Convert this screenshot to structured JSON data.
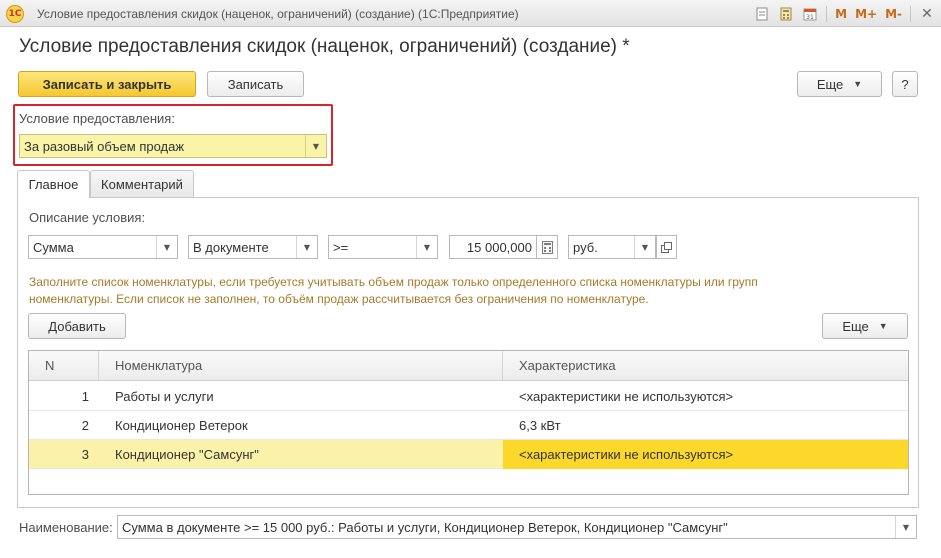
{
  "window": {
    "app_logo": "1С",
    "caption": "Условие предоставления скидок (наценок, ограничений) (создание)  (1С:Предприятие)",
    "icons": [
      "document-icon",
      "calculator-icon",
      "calendar-icon",
      "m-icon",
      "m-plus-icon",
      "m-minus-icon",
      "close-icon"
    ],
    "m": "M",
    "m_plus": "M+",
    "m_minus": "M-",
    "close": "✕"
  },
  "form": {
    "title": "Условие предоставления скидок (наценок, ограничений) (создание) *"
  },
  "toolbar": {
    "save_close_label": "Записать и закрыть",
    "save_label": "Записать",
    "more_label": "Еще",
    "help_label": "?"
  },
  "condition": {
    "label": "Условие предоставления:",
    "value": "За разовый объем продаж"
  },
  "tabs": [
    {
      "label": "Главное",
      "active": true
    },
    {
      "label": "Комментарий",
      "active": false
    }
  ],
  "description": {
    "label": "Описание условия:",
    "field1": "Сумма",
    "field2": "В документе",
    "field3": ">=",
    "amount": "15 000,000",
    "currency": "руб."
  },
  "hint": "Заполните список номенклатуры, если требуется учитывать объем продаж только определенного списка номенклатуры или групп номенклатуры. Если список не заполнен, то объём продаж рассчитывается без ограничения по номенклатуре.",
  "list_toolbar": {
    "add_label": "Добавить",
    "more_label": "Еще"
  },
  "table": {
    "columns": [
      "N",
      "Номенклатура",
      "Характеристика"
    ],
    "rows": [
      {
        "n": "1",
        "item": "Работы и услуги",
        "characteristic": "<характеристики не используются>"
      },
      {
        "n": "2",
        "item": "Кондиционер Ветерок",
        "characteristic": "6,3 кВт"
      },
      {
        "n": "3",
        "item": "Кондиционер \"Самсунг\"",
        "characteristic": "<характеристики не используются>"
      }
    ],
    "selected_row": 3
  },
  "name_field": {
    "label": "Наименование:",
    "value": "Сумма в документе >= 15 000 руб.: Работы и услуги, Кондиционер Ветерок, Кондиционер \"Самсунг\""
  },
  "colors": {
    "primary_button": "#f5c82f",
    "condition_highlight": "#d6262d",
    "selected_row": "#fbf2a9",
    "selected_cell": "#fcd82b",
    "hint_text": "#a67a2a"
  }
}
